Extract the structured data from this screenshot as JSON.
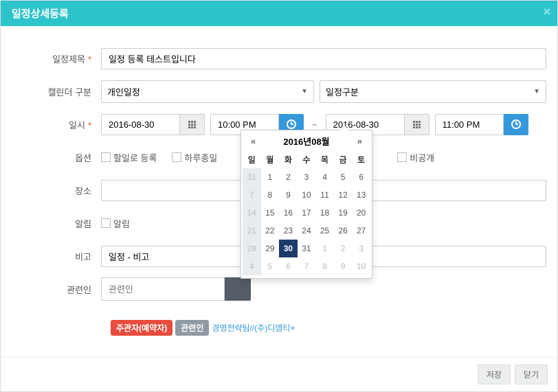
{
  "modal": {
    "title": "일정상세등록",
    "close": "×"
  },
  "labels": {
    "subject": "일정제목",
    "calendar": "캘린더 구분",
    "datetime": "일시",
    "options": "옵션",
    "place": "장소",
    "alarm": "알림",
    "memo": "비고",
    "related": "관련인"
  },
  "values": {
    "subject": "일정 등록 테스트입니다",
    "cal_type": "개인일정",
    "schedule_type": "일정구분",
    "start_date": "2016-08-30",
    "start_time": "10:00 PM",
    "end_date": "2016-08-30",
    "end_time": "11:00 PM",
    "tilde": "~",
    "memo": "일정 - 비고",
    "related_placeholder": "관련인"
  },
  "options": {
    "holiday": "할일로 등록",
    "allday": "하루종일",
    "private": "비공개",
    "alarm": "알림"
  },
  "tags": {
    "owner": "주관자(예약자)",
    "related": "관련인",
    "link": "경영전략팀//(주)디엠티",
    "remove": "×"
  },
  "footer": {
    "save": "저장",
    "close": "닫기"
  },
  "calendar": {
    "title": "2016년08월",
    "prev": "«",
    "next": "»",
    "dow": [
      "일",
      "월",
      "화",
      "수",
      "목",
      "금",
      "토"
    ],
    "weeks": [
      [
        {
          "d": "31",
          "t": "muted"
        },
        {
          "d": "1"
        },
        {
          "d": "2"
        },
        {
          "d": "3"
        },
        {
          "d": "4"
        },
        {
          "d": "5"
        },
        {
          "d": "6"
        }
      ],
      [
        {
          "d": "7",
          "t": "muted"
        },
        {
          "d": "8"
        },
        {
          "d": "9"
        },
        {
          "d": "10"
        },
        {
          "d": "11"
        },
        {
          "d": "12"
        },
        {
          "d": "13"
        }
      ],
      [
        {
          "d": "14",
          "t": "muted"
        },
        {
          "d": "15"
        },
        {
          "d": "16"
        },
        {
          "d": "17"
        },
        {
          "d": "18"
        },
        {
          "d": "19"
        },
        {
          "d": "20"
        }
      ],
      [
        {
          "d": "21",
          "t": "muted"
        },
        {
          "d": "22"
        },
        {
          "d": "23"
        },
        {
          "d": "24"
        },
        {
          "d": "25"
        },
        {
          "d": "26"
        },
        {
          "d": "27"
        }
      ],
      [
        {
          "d": "28",
          "t": "muted"
        },
        {
          "d": "29"
        },
        {
          "d": "30",
          "t": "selected"
        },
        {
          "d": "31"
        },
        {
          "d": "1",
          "t": "muted-light"
        },
        {
          "d": "2",
          "t": "muted-light"
        },
        {
          "d": "3",
          "t": "muted-light"
        }
      ],
      [
        {
          "d": "4",
          "t": "muted"
        },
        {
          "d": "5",
          "t": "muted-light"
        },
        {
          "d": "6",
          "t": "muted-light"
        },
        {
          "d": "7",
          "t": "muted-light"
        },
        {
          "d": "8",
          "t": "muted-light"
        },
        {
          "d": "9",
          "t": "muted-light"
        },
        {
          "d": "10",
          "t": "muted-light"
        }
      ]
    ]
  }
}
